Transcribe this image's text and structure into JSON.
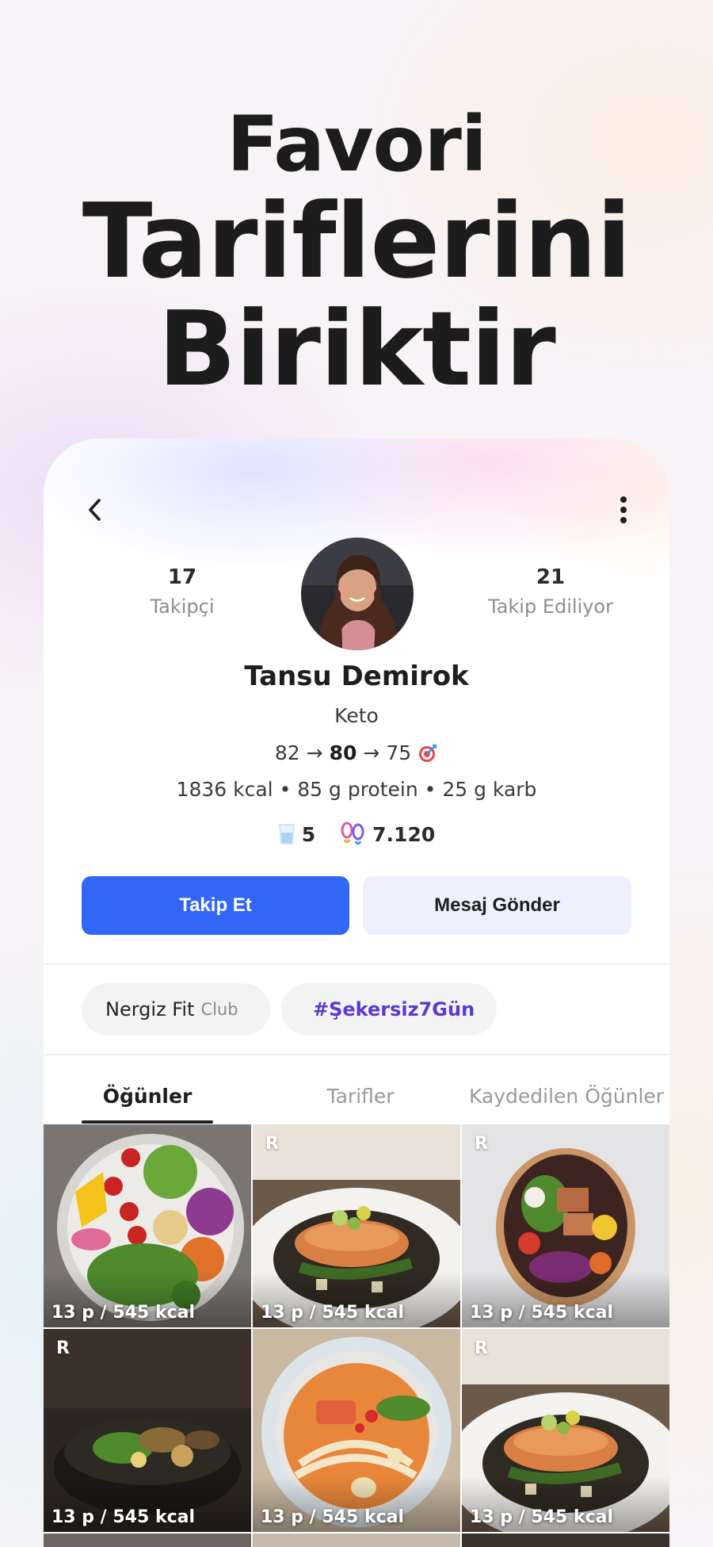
{
  "headline": {
    "line1": "Favori",
    "line2": "Tariflerini",
    "line3": "Biriktir"
  },
  "profile": {
    "followers_count": "17",
    "followers_label": "Takipçi",
    "following_count": "21",
    "following_label": "Takip Ediliyor",
    "name": "Tansu Demirok",
    "diet": "Keto",
    "weight_start": "82",
    "weight_current": "80",
    "weight_goal": "75",
    "arrow": "→",
    "macros": "1836 kcal • 85 g protein • 25 g karb",
    "water_glasses": "5",
    "steps": "7.120"
  },
  "actions": {
    "follow_label": "Takip Et",
    "message_label": "Mesaj Gönder"
  },
  "chips": {
    "club_name": "Nergiz Fit",
    "club_suffix": "Club",
    "hashtag": "#Şekersiz7Gün"
  },
  "tabs": [
    {
      "label": "Öğünler",
      "active": true
    },
    {
      "label": "Tarifler",
      "active": false
    },
    {
      "label": "Kaydedilen Öğünler",
      "active": false
    }
  ],
  "grid": [
    {
      "badge": "",
      "caption": "13 p / 545 kcal",
      "image": "veggie-bowl"
    },
    {
      "badge": "R",
      "caption": "13 p / 545 kcal",
      "image": "salmon-plate"
    },
    {
      "badge": "R",
      "caption": "13 p / 545 kcal",
      "image": "salmon-salad-bowl"
    },
    {
      "badge": "R",
      "caption": "13 p / 545 kcal",
      "image": "dark-salad-bowl"
    },
    {
      "badge": "",
      "caption": "13 p / 545 kcal",
      "image": "noodle-soup"
    },
    {
      "badge": "R",
      "caption": "13 p / 545 kcal",
      "image": "salmon-plate"
    }
  ],
  "colors": {
    "primary": "#3266f7",
    "secondary_bg": "#eef1fd",
    "hashtag": "#5b3ad1",
    "live_dot": "#26b07c"
  }
}
